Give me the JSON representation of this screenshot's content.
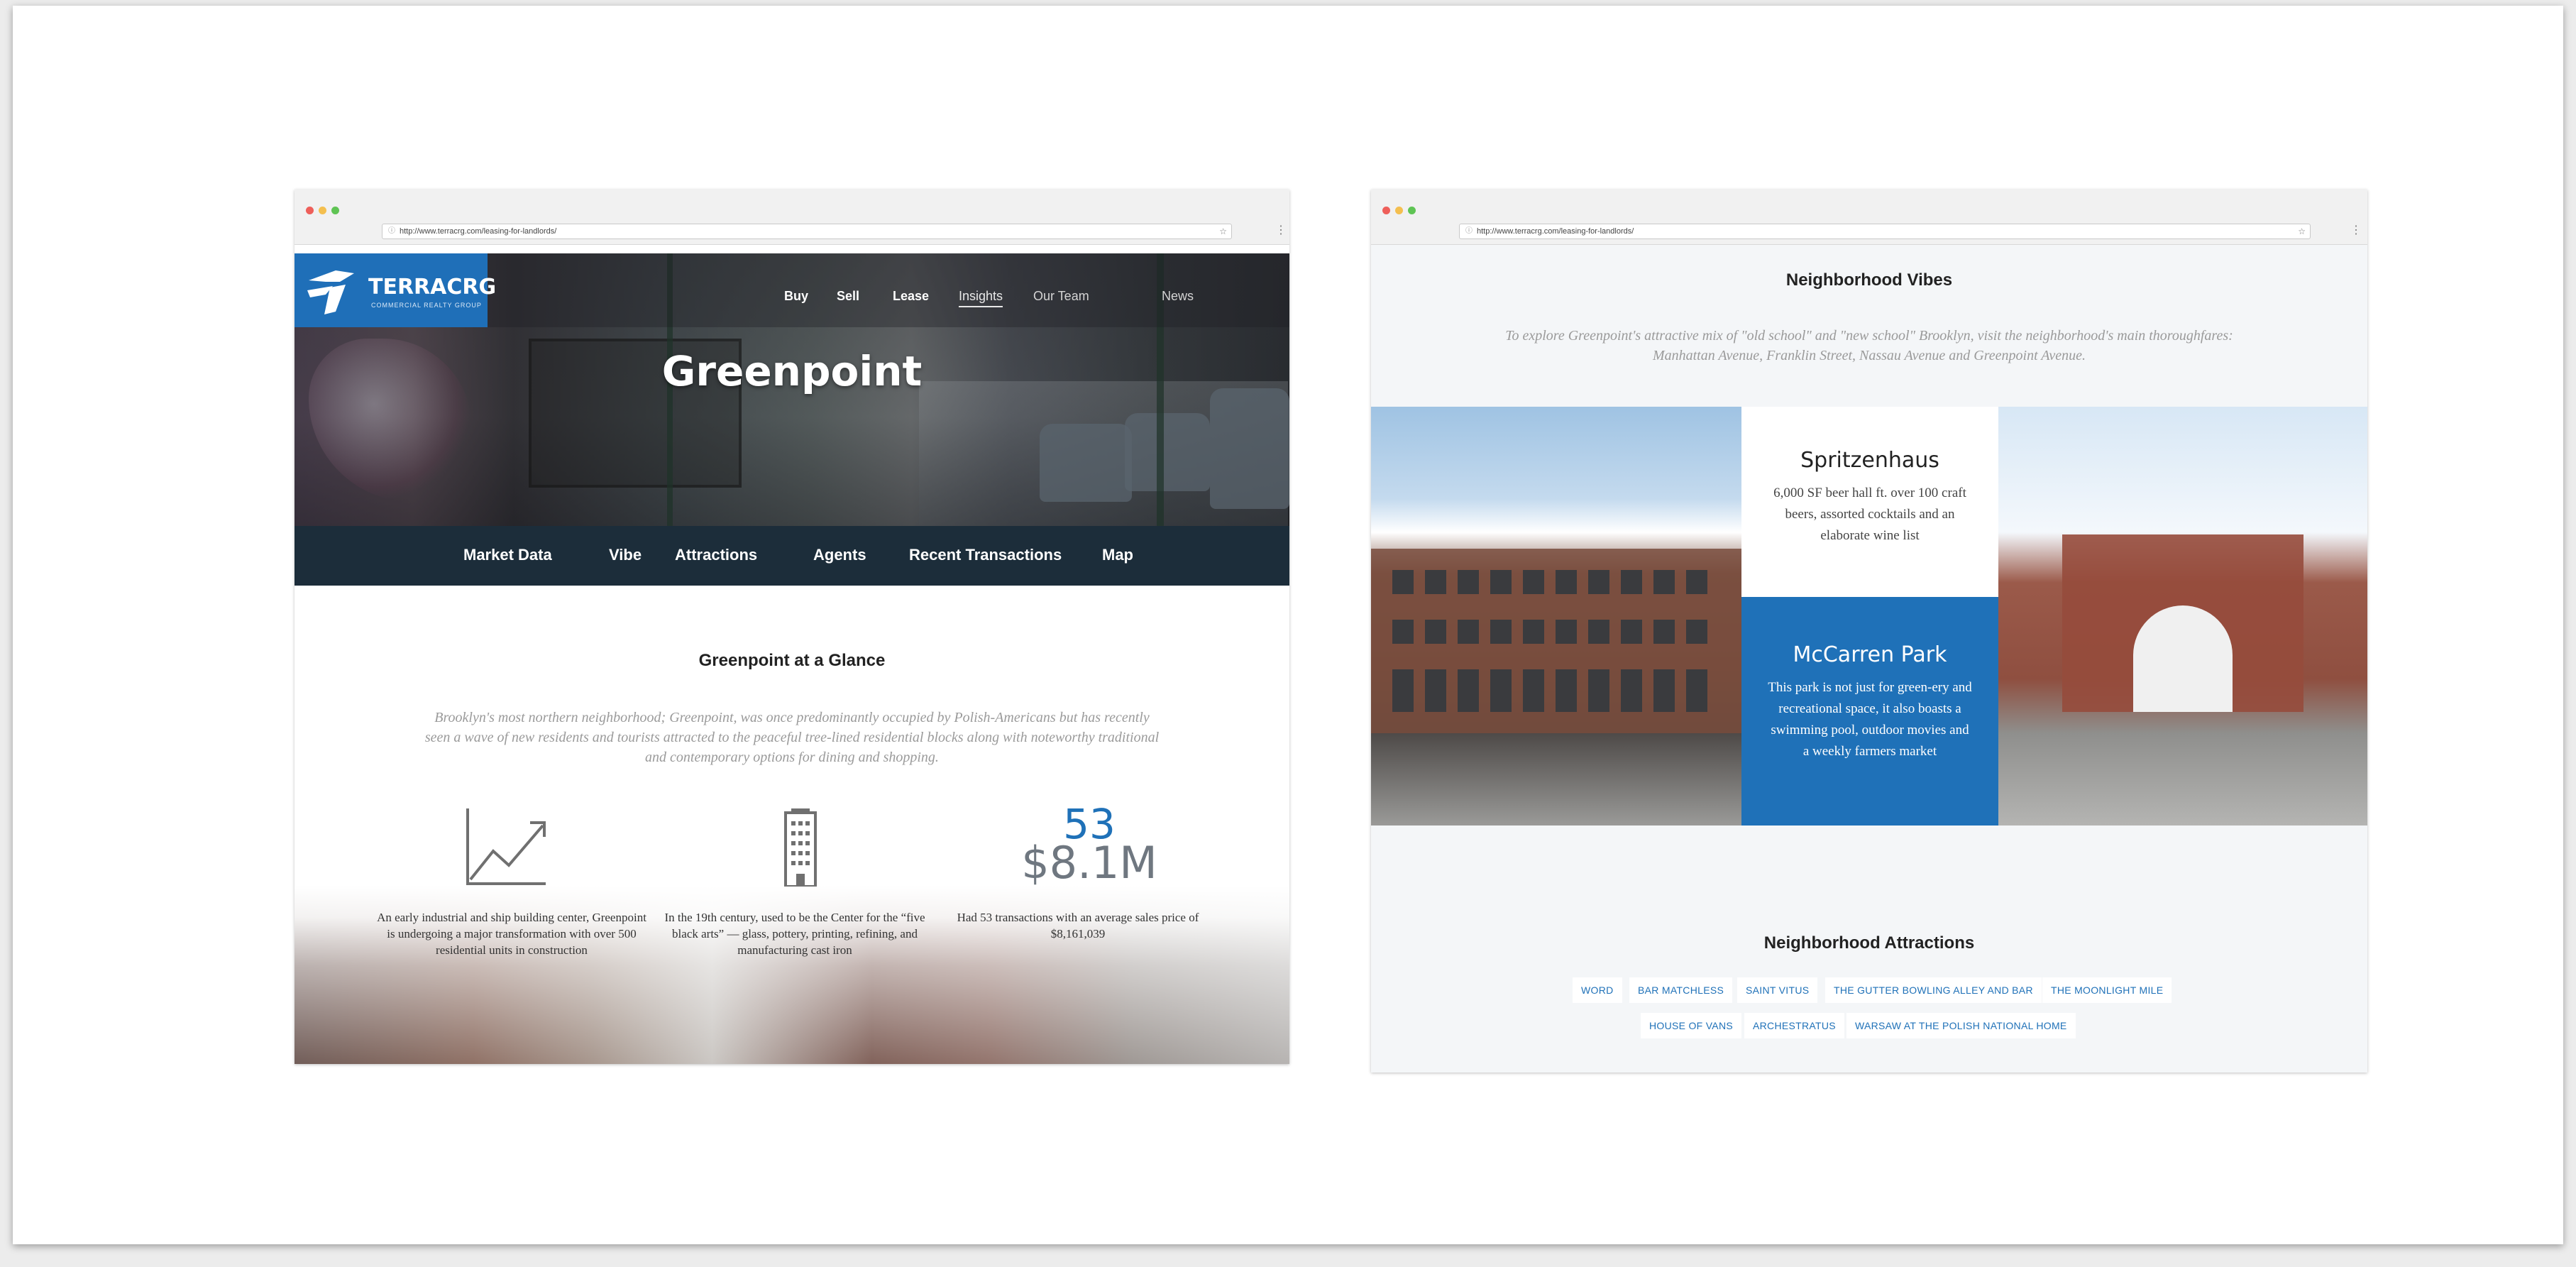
{
  "left_window": {
    "url": "http://www.terracrg.com/leasing-for-landlords/",
    "logo": {
      "name": "TERRACRG",
      "tagline": "COMMERCIAL REALTY GROUP"
    },
    "nav": [
      {
        "label": "Buy"
      },
      {
        "label": "Sell"
      },
      {
        "label": "Lease"
      },
      {
        "label": "Insights"
      },
      {
        "label": "Our Team"
      },
      {
        "label": "News"
      }
    ],
    "hero_title": "Greenpoint",
    "subnav": [
      {
        "label": "Market Data"
      },
      {
        "label": "Vibe"
      },
      {
        "label": "Attractions"
      },
      {
        "label": "Agents"
      },
      {
        "label": "Recent Transactions"
      },
      {
        "label": "Map"
      }
    ],
    "glance_title": "Greenpoint at a Glance",
    "glance_intro": "Brooklyn's most northern neighborhood; Greenpoint, was once predominantly occupied by Polish-Americans but has recently seen a wave of new residents and tourists attracted to the peaceful tree-lined residential blocks along with noteworthy traditional and contemporary options for dining and shopping.",
    "stats": [
      {
        "icon": "trend-chart-icon",
        "text": "An early industrial and ship building center, Greenpoint is undergoing a major transformation with over 500 residential units in construction"
      },
      {
        "icon": "building-icon",
        "text": "In the 19th century, used to be the Center for the “five black arts” — glass, pottery, printing, refining, and manufacturing cast iron"
      },
      {
        "big_top": "53",
        "big_bottom": "$8.1M",
        "text": "Had 53 transactions with an average sales price of $8,161,039"
      }
    ],
    "colors": {
      "brand_blue": "#1f6fb8",
      "subnav_bg": "#1c2d3a",
      "stat_blue": "#1f71b8",
      "stat_gray": "#6f7780"
    }
  },
  "right_window": {
    "url": "http://www.terracrg.com/leasing-for-landlords/",
    "vibes_title": "Neighborhood Vibes",
    "vibes_intro": "To explore Greenpoint's attractive mix of \"old school\" and \"new school\" Brooklyn, visit the neighborhood's main thoroughfares: Manhattan Avenue, Franklin Street, Nassau Avenue and Greenpoint Avenue.",
    "card_a": {
      "title": "Spritzenhaus",
      "text": "6,000 SF beer hall ft. over 100 craft beers, assorted cocktails and an elaborate wine list"
    },
    "card_b": {
      "title": "McCarren Park",
      "text": "This park is not just for green-ery and recreational space, it also boasts a swimming pool, outdoor movies and a weekly farmers market"
    },
    "attractions_title": "Neighborhood Attractions",
    "attractions_row1": [
      "WORD",
      "BAR MATCHLESS",
      "SAINT VITUS",
      "THE GUTTER BOWLING ALLEY AND BAR",
      "THE MOONLIGHT MILE"
    ],
    "attractions_row2": [
      "HOUSE OF VANS",
      "ARCHESTRATUS",
      "WARSAW AT THE POLISH NATIONAL HOME"
    ]
  }
}
